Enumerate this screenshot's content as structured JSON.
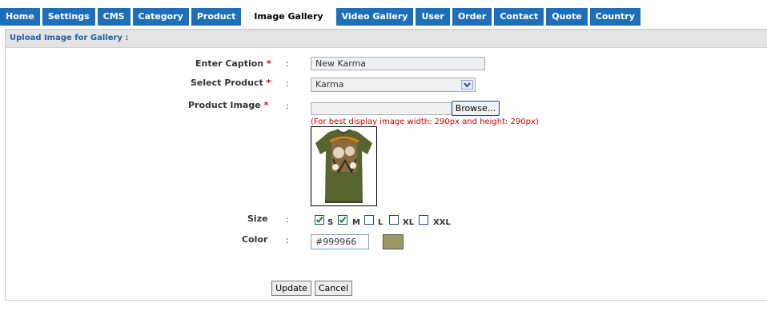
{
  "nav": {
    "tabs": [
      {
        "label": "Home"
      },
      {
        "label": "Settings"
      },
      {
        "label": "CMS"
      },
      {
        "label": "Category"
      },
      {
        "label": "Product"
      },
      {
        "label": "Image Gallery"
      },
      {
        "label": "Video Gallery"
      },
      {
        "label": "User"
      },
      {
        "label": "Order"
      },
      {
        "label": "Contact"
      },
      {
        "label": "Quote"
      },
      {
        "label": "Country"
      }
    ],
    "active_tab": "Image Gallery",
    "tab_color": "#1f6fb8"
  },
  "panel": {
    "title": "Upload Image for Gallery :"
  },
  "form": {
    "required_mark": "*",
    "separator": ":",
    "caption": {
      "label": "Enter Caption",
      "value": "New Karma"
    },
    "product": {
      "label": "Select Product",
      "selected": "Karma"
    },
    "image": {
      "label": "Product Image",
      "browse_label": "Browse...",
      "hint": "(For best display image width: 290px and height: 290px)",
      "preview_icon": "green-tshirt-image"
    },
    "size": {
      "label": "Size",
      "options": [
        {
          "label": "S",
          "checked": true
        },
        {
          "label": "M",
          "checked": true
        },
        {
          "label": "L",
          "checked": false
        },
        {
          "label": "XL",
          "checked": false
        },
        {
          "label": "XXL",
          "checked": false
        }
      ]
    },
    "color": {
      "label": "Color",
      "value": "#999966",
      "swatch": "#999966"
    },
    "buttons": {
      "update": "Update",
      "cancel": "Cancel"
    }
  }
}
